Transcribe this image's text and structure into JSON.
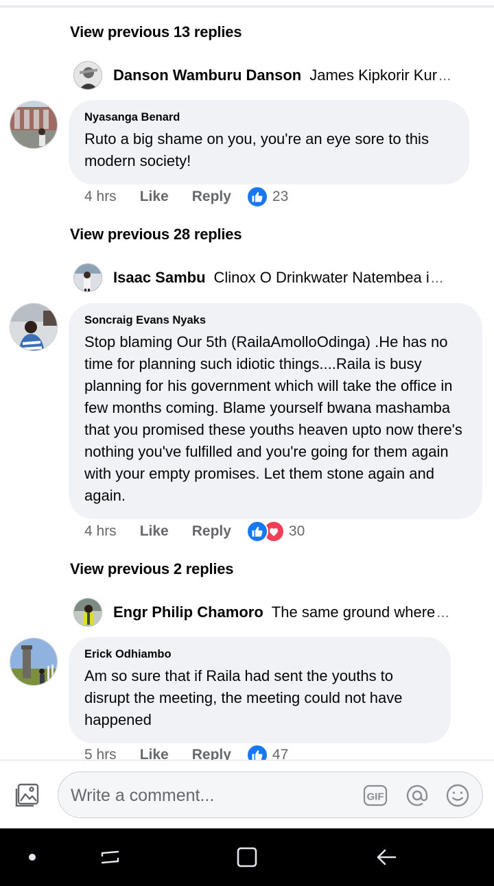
{
  "threads": [
    {
      "view_previous": "View previous 13 replies",
      "reply_preview": {
        "name": "Danson Wamburu Danson",
        "text": "James Kipkorir Kur",
        "ellipsis": "..."
      },
      "comment": {
        "author": "Nyasanga Benard",
        "text": "Ruto a big shame on you, you're an eye sore to this modern society!",
        "time": "4 hrs",
        "like_label": "Like",
        "reply_label": "Reply",
        "reactions": [
          "like"
        ],
        "reaction_count": "23"
      }
    },
    {
      "view_previous": "View previous 28 replies",
      "reply_preview": {
        "name": "Isaac Sambu",
        "text": "Clinox O Drinkwater  Natembea i",
        "ellipsis": "..."
      },
      "comment": {
        "author": "Soncraig Evans Nyaks",
        "text": "Stop blaming Our 5th (RailaAmolloOdinga) .He has no time for planning such idiotic things....Raila is busy planning for his government which will take the office in few months coming. Blame yourself bwana mashamba  that you promised these youths heaven upto now there's nothing you've fulfilled and you're going for them again with your empty promises. Let them stone again and again.",
        "time": "4 hrs",
        "like_label": "Like",
        "reply_label": "Reply",
        "reactions": [
          "like",
          "love"
        ],
        "reaction_count": "30"
      }
    },
    {
      "view_previous": "View previous 2 replies",
      "reply_preview": {
        "name": "Engr Philip Chamoro",
        "text": "The same ground where",
        "ellipsis": "..."
      },
      "comment": {
        "author": "Erick Odhiambo",
        "text": "Am so sure that if Raila had sent the youths to disrupt the meeting, the meeting could not have happened",
        "time": "5 hrs",
        "like_label": "Like",
        "reply_label": "Reply",
        "reactions": [
          "like"
        ],
        "reaction_count": "47"
      }
    }
  ],
  "composer": {
    "placeholder": "Write a comment...",
    "icons": [
      "photo-icon",
      "gif-icon",
      "mention-icon",
      "emoji-icon"
    ],
    "gif_label": "GIF"
  },
  "navbar": {
    "icons": [
      "dot-icon",
      "recent-apps-icon",
      "home-icon",
      "back-icon"
    ]
  },
  "colors": {
    "bubble_bg": "#f0f2f5",
    "secondary_text": "#65676b",
    "like_blue": "#1877f2",
    "love_red": "#f33e58",
    "navbar_bg": "#000000"
  }
}
